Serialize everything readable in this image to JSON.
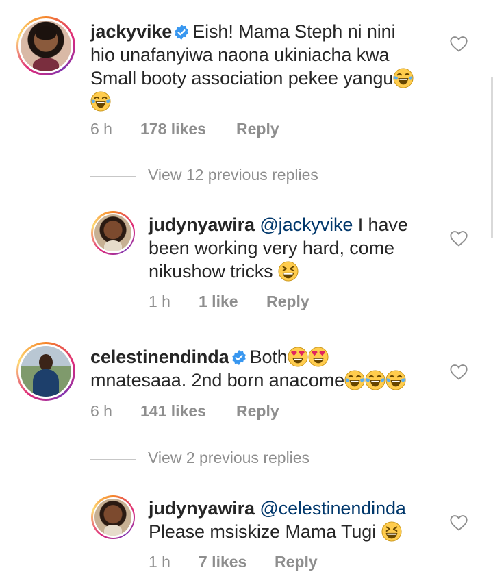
{
  "comments": [
    {
      "username": "jackyvike",
      "verified": true,
      "text_lines": [
        "Eish! Mama Steph ni nini",
        "hio unafanyiwa naona ukiniacha kwa",
        "Small booty association pekee yangu"
      ],
      "time": "6 h",
      "likes": "178 likes",
      "reply": "Reply"
    },
    {
      "view_replies": "View 12 previous replies"
    },
    {
      "username": "judynyawira",
      "mention": "@jackyvike",
      "text_lines": [
        " I have",
        "been working very hard, come",
        "nikushow tricks "
      ],
      "time": "1 h",
      "likes": "1 like",
      "reply": "Reply"
    },
    {
      "username": "celestinendinda",
      "verified": true,
      "text_lines": [
        "Both",
        "mnatesaaa. 2nd born anacome"
      ],
      "time": "6 h",
      "likes": "141 likes",
      "reply": "Reply"
    },
    {
      "view_replies": "View 2 previous replies"
    },
    {
      "username": "judynyawira",
      "mention": "@celestinendinda",
      "text_lines": [
        "Please msiskize Mama Tugi "
      ],
      "time": "1 h",
      "likes": "7 likes",
      "reply": "Reply"
    }
  ],
  "icons": {
    "heart": "heart-outline-icon",
    "verified": "verified-badge-icon",
    "laugh_emoji": "tears-of-joy-emoji",
    "grin_emoji": "grinning-squinting-emoji",
    "heart_eyes_emoji": "heart-eyes-emoji"
  },
  "colors": {
    "text": "#262626",
    "meta": "#8e8e8e",
    "mention": "#00376b",
    "verified": "#3897f0"
  }
}
